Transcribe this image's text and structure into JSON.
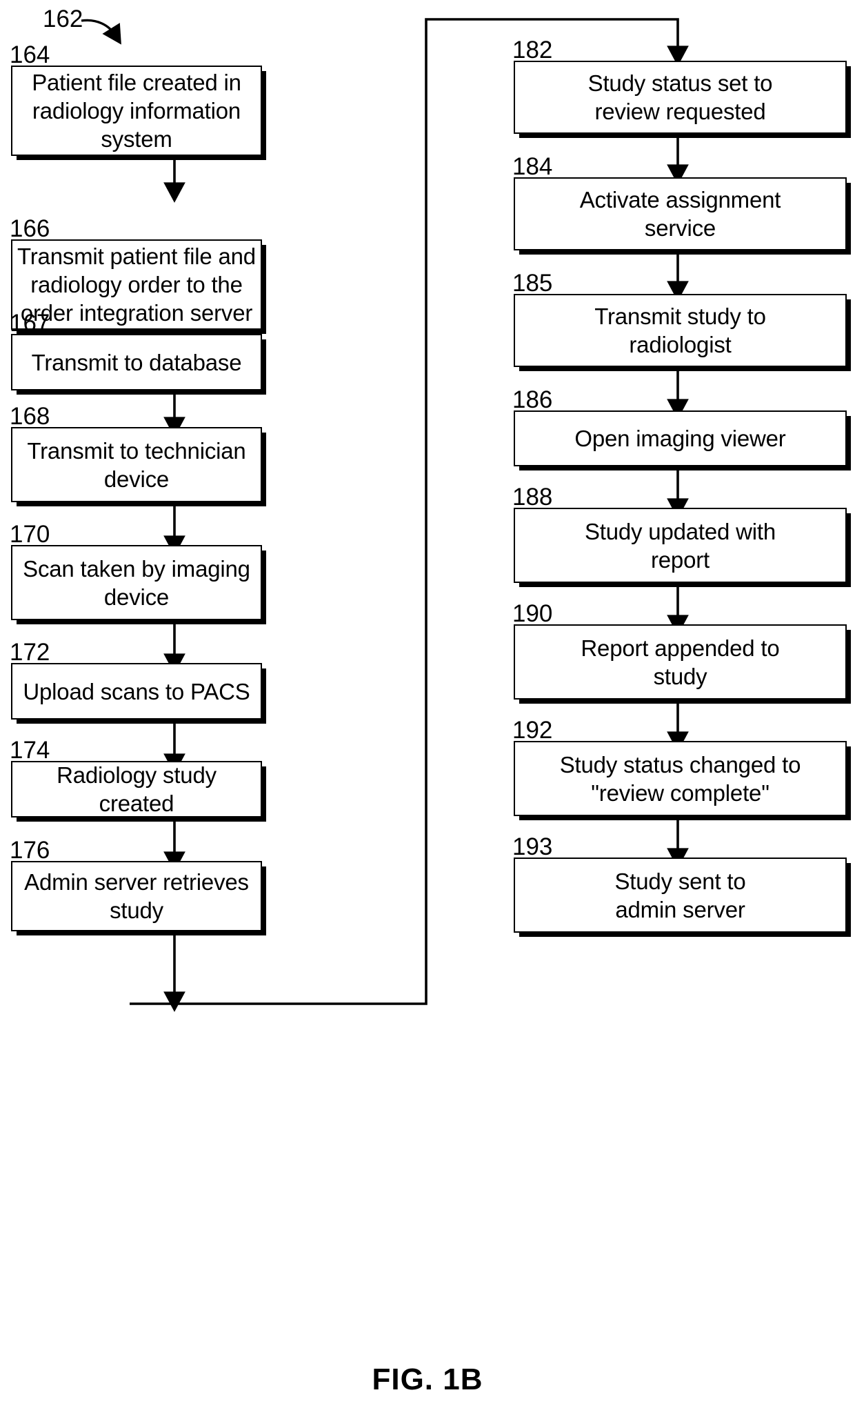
{
  "figure": {
    "caption": "FIG. 1B",
    "diagram_ref": "162"
  },
  "diagram": {
    "type": "flowchart",
    "orientation": "two-column, top-to-bottom, left column then right column",
    "left_column": [
      {
        "ref": "164",
        "text": "Patient file created in\nradiology information\nsystem"
      },
      {
        "ref": "166",
        "text": "Transmit patient file and\nradiology order to the\norder integration server"
      },
      {
        "ref": "167",
        "text": "Transmit to database"
      },
      {
        "ref": "168",
        "text": "Transmit to technician\ndevice"
      },
      {
        "ref": "170",
        "text": "Scan taken by imaging\ndevice"
      },
      {
        "ref": "172",
        "text": "Upload scans to PACS"
      },
      {
        "ref": "174",
        "text": "Radiology study created"
      },
      {
        "ref": "176",
        "text": "Admin server retrieves\nstudy"
      }
    ],
    "right_column": [
      {
        "ref": "182",
        "text": "Study status set to\nreview requested"
      },
      {
        "ref": "184",
        "text": "Activate assignment\nservice"
      },
      {
        "ref": "185",
        "text": "Transmit study to\nradiologist"
      },
      {
        "ref": "186",
        "text": "Open imaging viewer"
      },
      {
        "ref": "188",
        "text": "Study updated with\nreport"
      },
      {
        "ref": "190",
        "text": "Report appended to\nstudy"
      },
      {
        "ref": "192",
        "text": "Study status changed to\n\"review complete\""
      },
      {
        "ref": "193",
        "text": "Study sent to\nadmin server"
      }
    ],
    "colors": {
      "stroke": "#000000",
      "fill": "#ffffff",
      "background": "#ffffff"
    }
  }
}
